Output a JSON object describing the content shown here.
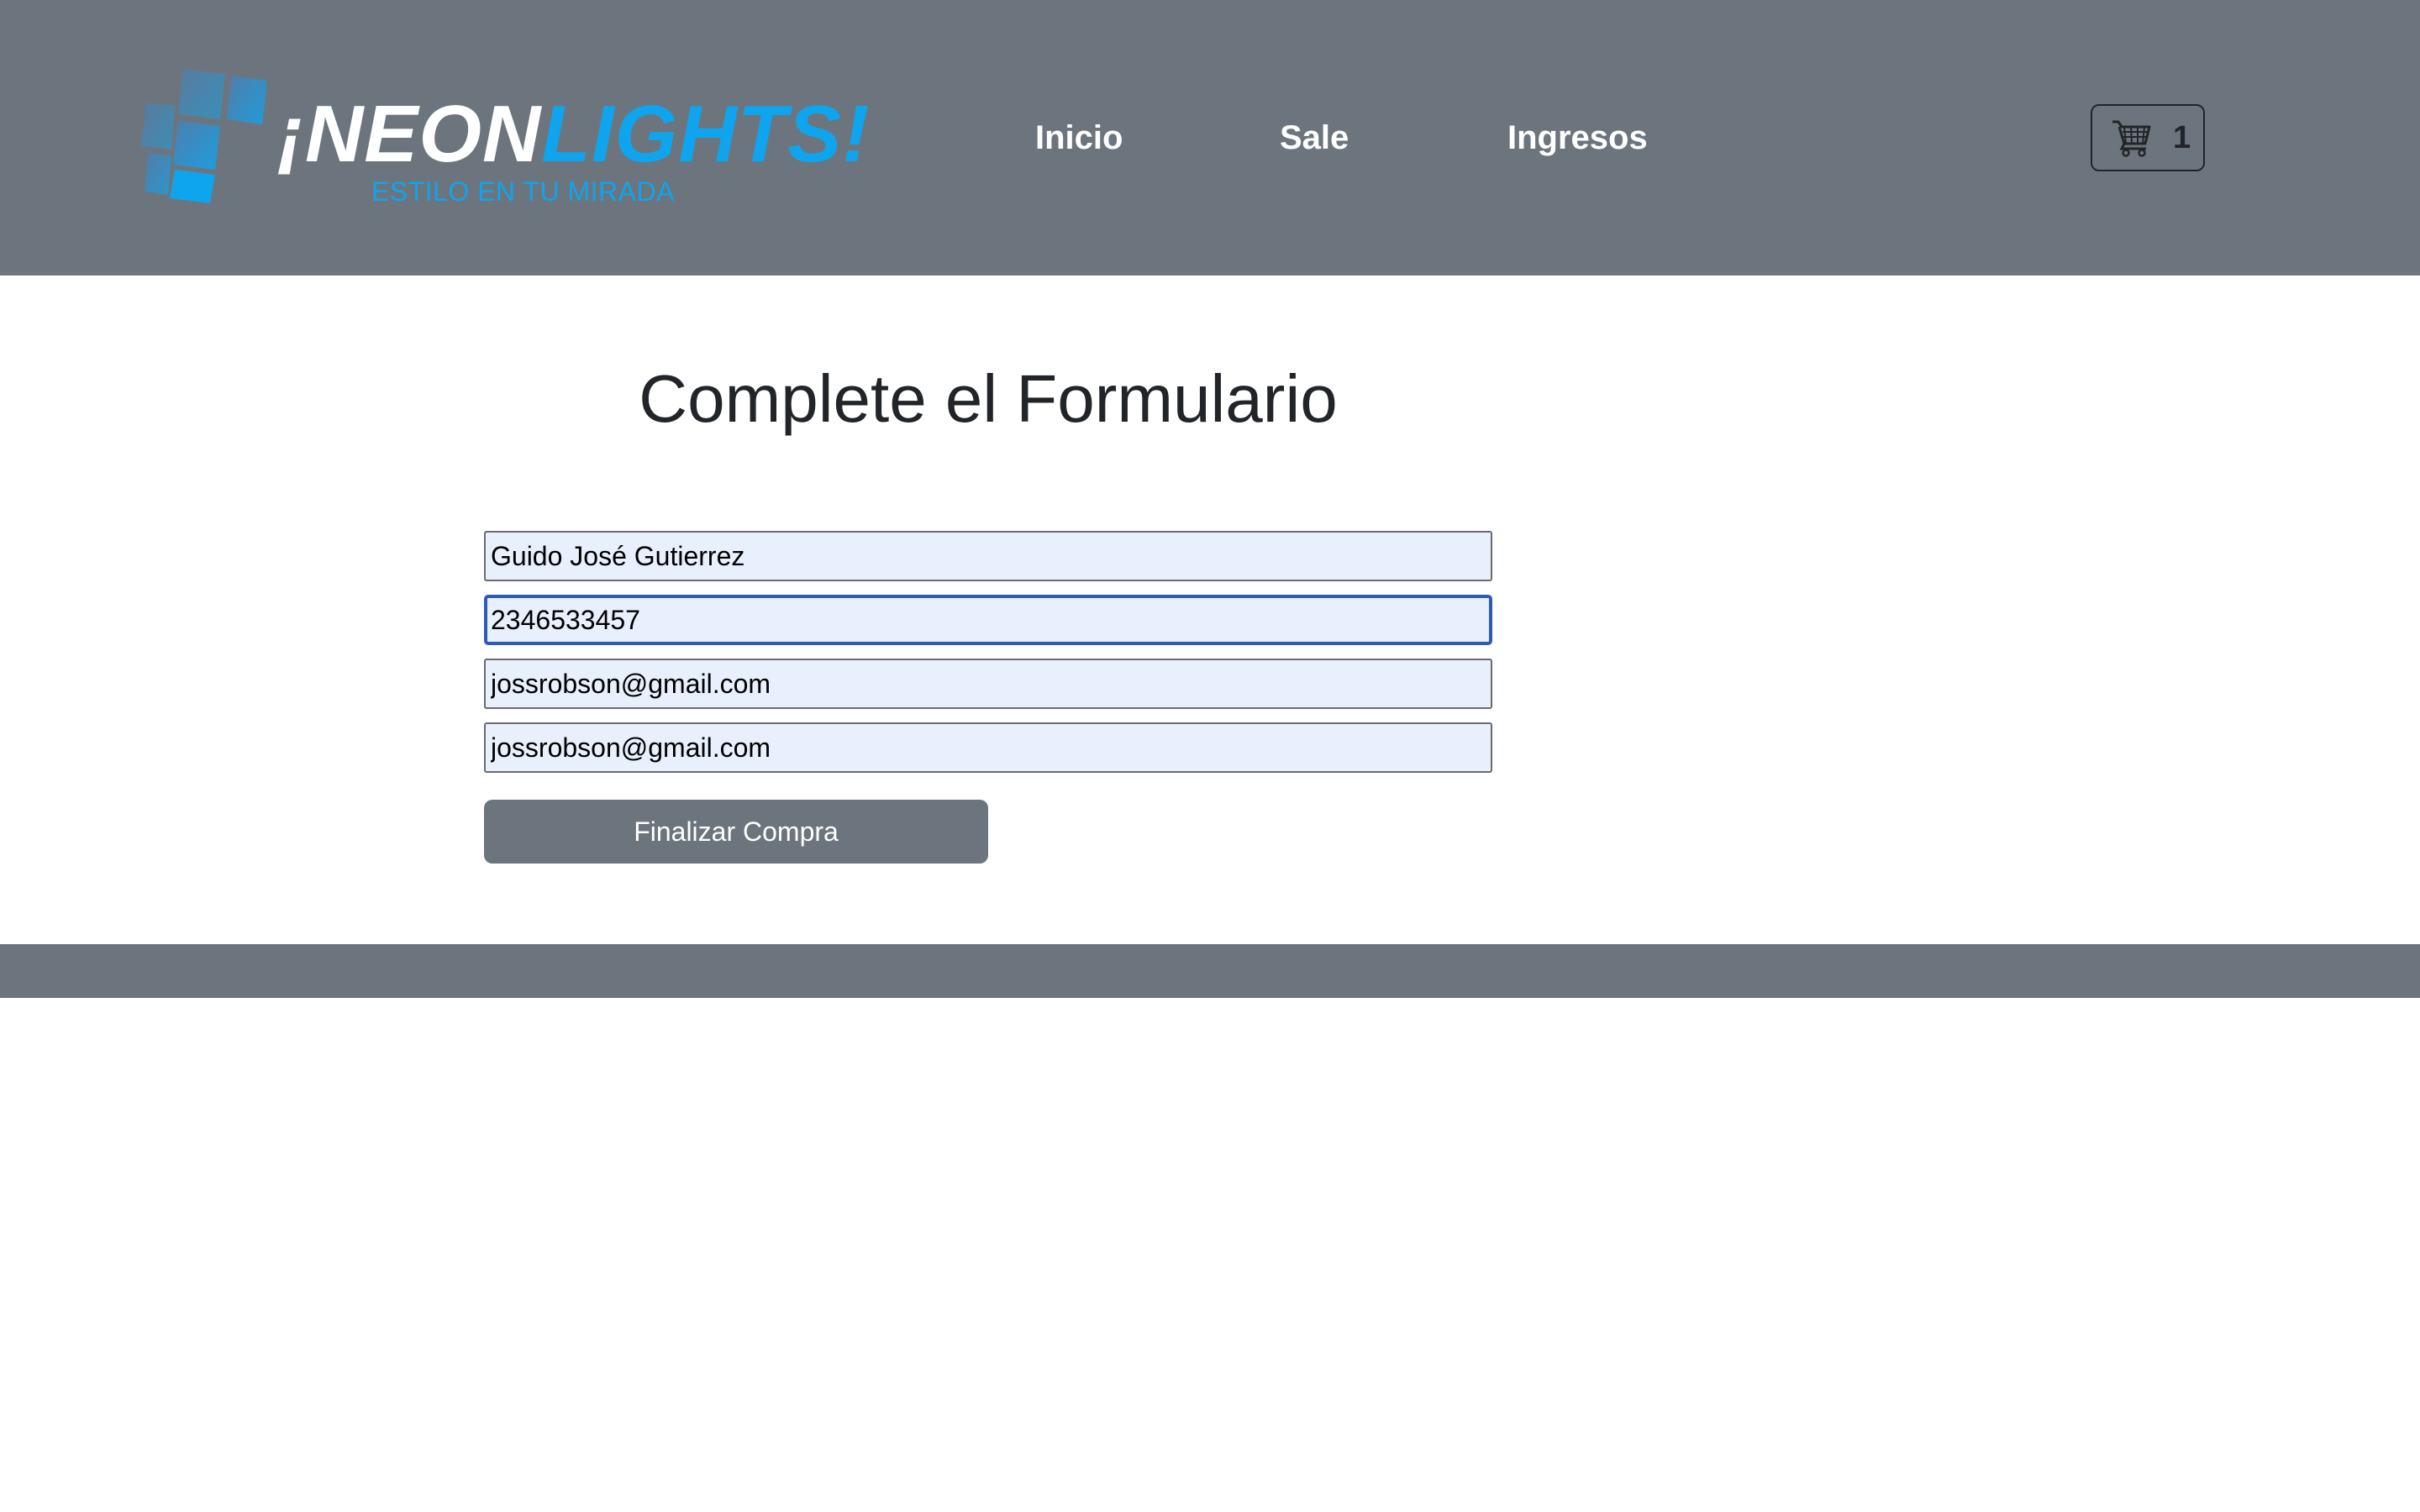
{
  "header": {
    "logo": {
      "title_white": "¡NEON",
      "title_blue": "LIGHTS!",
      "tagline": "ESTILO EN TU MIRADA",
      "icon": "tiles-logo-icon"
    },
    "nav": [
      {
        "label": "Inicio"
      },
      {
        "label": "Sale"
      },
      {
        "label": "Ingresos"
      }
    ],
    "cart": {
      "icon": "cart-icon",
      "count": "1"
    }
  },
  "main": {
    "title": "Complete el Formulario",
    "form": {
      "name_value": "Guido José Gutierrez",
      "phone_value": "2346533457",
      "email_value": "jossrobson@gmail.com",
      "email_confirm_value": "jossrobson@gmail.com",
      "submit_label": "Finalizar Compra"
    }
  },
  "colors": {
    "header_bg": "#6c757d",
    "brand_blue": "#0ea5ee",
    "autofill_bg": "#e8f0fe",
    "focus_border": "#2c5bb8"
  }
}
